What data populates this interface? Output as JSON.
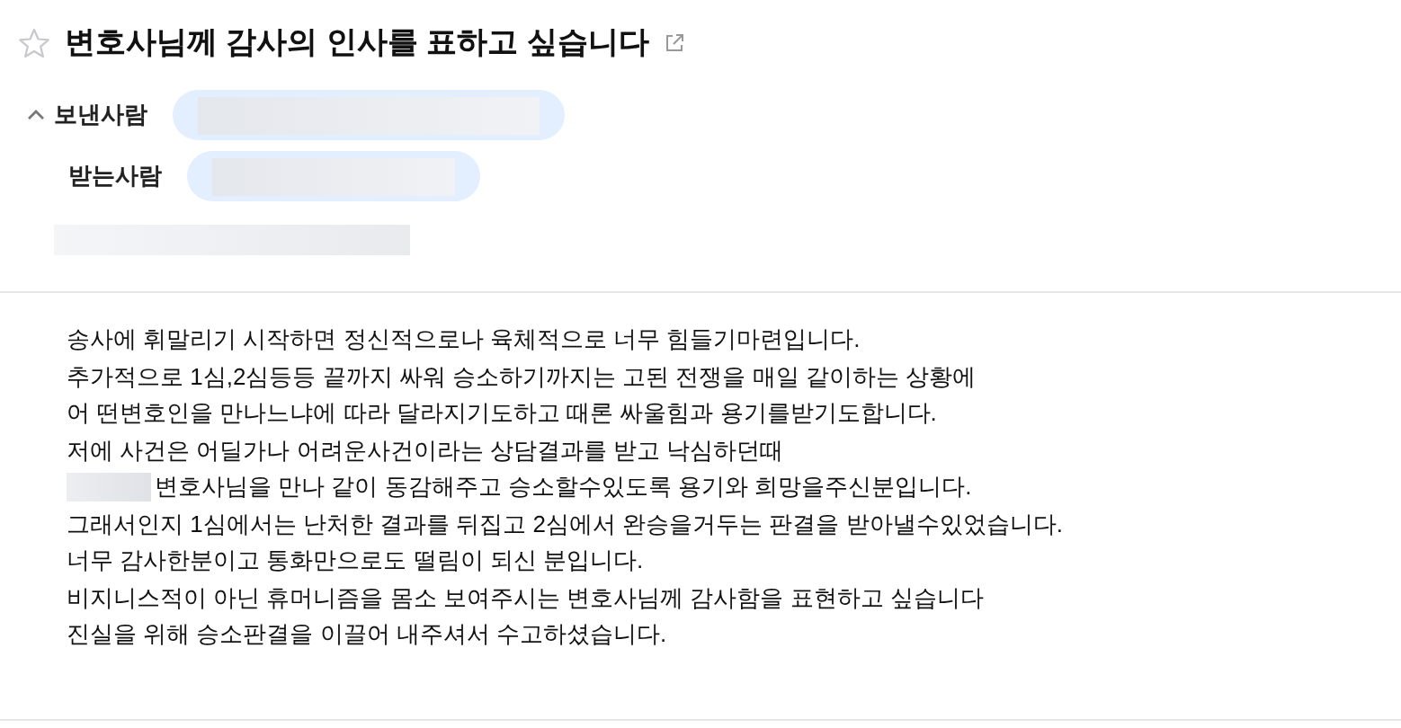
{
  "subject": {
    "title": "변호사님께 감사의 인사를 표하고 싶습니다",
    "starred": false
  },
  "header": {
    "expanded": true,
    "fields": [
      {
        "label": "보낸사람",
        "kind": "pill"
      },
      {
        "label": "받는사람",
        "kind": "pill"
      }
    ]
  },
  "body": [
    {
      "text": "송사에 휘말리기 시작하면 정신적으로나 육체적으로 너무 힘들기마련입니다.",
      "redacted_prefix": false
    },
    {
      "text": "추가적으로 1심,2심등등 끝까지 싸워 승소하기까지는 고된 전쟁을 매일 같이하는 상황에",
      "redacted_prefix": false
    },
    {
      "text": "어 떤변호인을 만나느냐에 따라 달라지기도하고 때론 싸울힘과 용기를받기도합니다.",
      "redacted_prefix": false
    },
    {
      "text": "저에 사건은 어딜가나 어려운사건이라는 상담결과를 받고 낙심하던때",
      "redacted_prefix": false
    },
    {
      "text": "변호사님을 만나 같이 동감해주고 승소할수있도록 용기와 희망을주신분입니다.",
      "redacted_prefix": true
    },
    {
      "text": "그래서인지 1심에서는 난처한 결과를 뒤집고 2심에서 완승을거두는 판결을 받아낼수있었습니다.",
      "redacted_prefix": false
    },
    {
      "text": "너무 감사한분이고 통화만으로도 떨림이 되신 분입니다.",
      "redacted_prefix": false
    },
    {
      "text": "비지니스적이 아닌 휴머니즘을 몸소 보여주시는 변호사님께 감사함을 표현하고 싶습니다",
      "redacted_prefix": false
    },
    {
      "text": "진실을 위해 승소판결을 이끌어 내주셔서 수고하셨습니다.",
      "redacted_prefix": false
    }
  ]
}
